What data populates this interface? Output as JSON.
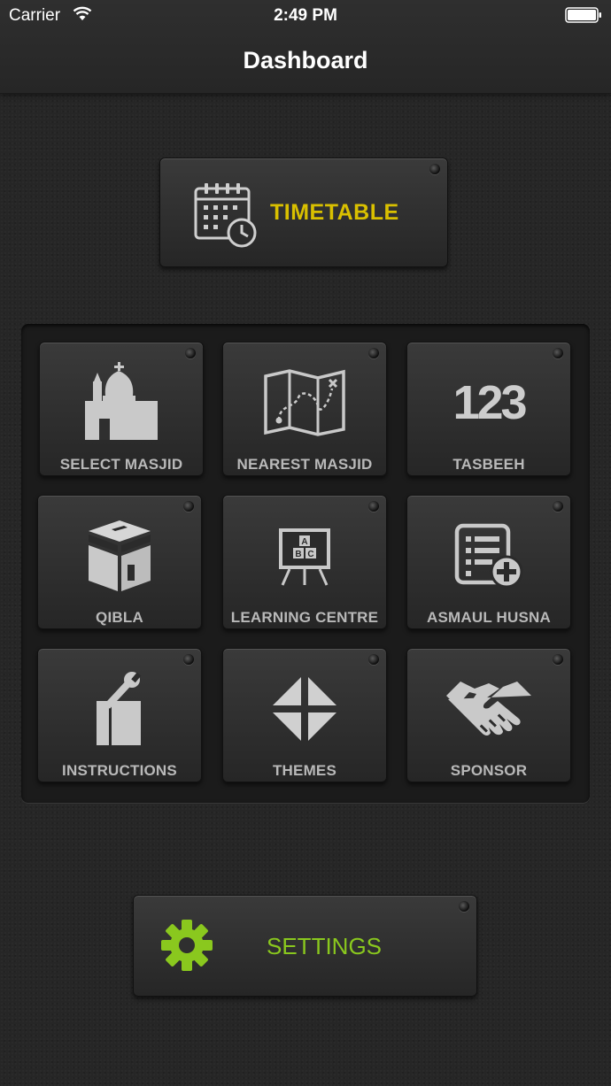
{
  "status_bar": {
    "carrier": "Carrier",
    "time": "2:49 PM"
  },
  "nav": {
    "title": "Dashboard"
  },
  "timetable": {
    "label": "TIMETABLE",
    "icon": "calendar-clock-icon",
    "color": "#d9c000"
  },
  "grid": [
    {
      "label": "SELECT MASJID",
      "icon": "mosque-icon"
    },
    {
      "label": "NEAREST MASJID",
      "icon": "map-icon"
    },
    {
      "label": "TASBEEH",
      "icon": "counter-123-icon"
    },
    {
      "label": "QIBLA",
      "icon": "kaaba-icon"
    },
    {
      "label": "LEARNING CENTRE",
      "icon": "chalkboard-icon"
    },
    {
      "label": "ASMAUL HUSNA",
      "icon": "list-add-icon"
    },
    {
      "label": "INSTRUCTIONS",
      "icon": "wrench-document-icon"
    },
    {
      "label": "THEMES",
      "icon": "quadrant-arrows-icon"
    },
    {
      "label": "SPONSOR",
      "icon": "handshake-icon"
    }
  ],
  "settings": {
    "label": "SETTINGS",
    "icon": "gear-icon",
    "color": "#8ac81e"
  },
  "icon_123": "123",
  "chalkboard_letters": [
    "A",
    "B",
    "C"
  ]
}
